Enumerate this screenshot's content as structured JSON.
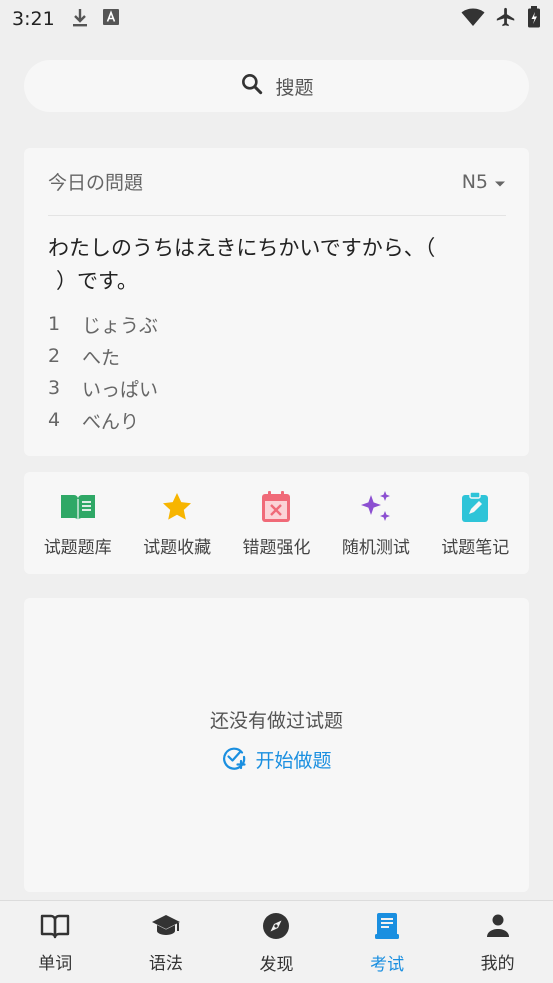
{
  "status_bar": {
    "time": "3:21"
  },
  "search": {
    "placeholder": "搜题"
  },
  "daily": {
    "title": "今日の問題",
    "level": "N5",
    "question_line1": "わたしのうちはえきにちかいですから、（",
    "question_line2": "）です。",
    "options": [
      {
        "num": "1",
        "text": "じょうぶ"
      },
      {
        "num": "2",
        "text": "へた"
      },
      {
        "num": "3",
        "text": "いっぱい"
      },
      {
        "num": "4",
        "text": "べんり"
      }
    ]
  },
  "tools": [
    {
      "label": "试题题库",
      "icon": "book-open-icon",
      "color": "#2fa866"
    },
    {
      "label": "试题收藏",
      "icon": "star-icon",
      "color": "#f7b500"
    },
    {
      "label": "错题强化",
      "icon": "calendar-x-icon",
      "color": "#f06a78"
    },
    {
      "label": "随机测试",
      "icon": "sparkle-icon",
      "color": "#8c4fd1"
    },
    {
      "label": "试题笔记",
      "icon": "clipboard-edit-icon",
      "color": "#2ec4d8"
    }
  ],
  "history": {
    "empty_text": "还没有做过试题",
    "start_label": "开始做题"
  },
  "nav": [
    {
      "label": "单词",
      "icon": "book-icon",
      "active": false
    },
    {
      "label": "语法",
      "icon": "graduation-cap-icon",
      "active": false
    },
    {
      "label": "发现",
      "icon": "compass-icon",
      "active": false
    },
    {
      "label": "考试",
      "icon": "exam-doc-icon",
      "active": true
    },
    {
      "label": "我的",
      "icon": "person-icon",
      "active": false
    }
  ],
  "colors": {
    "accent": "#1a8fe0",
    "background": "#efefef",
    "card": "#f7f7f7"
  }
}
